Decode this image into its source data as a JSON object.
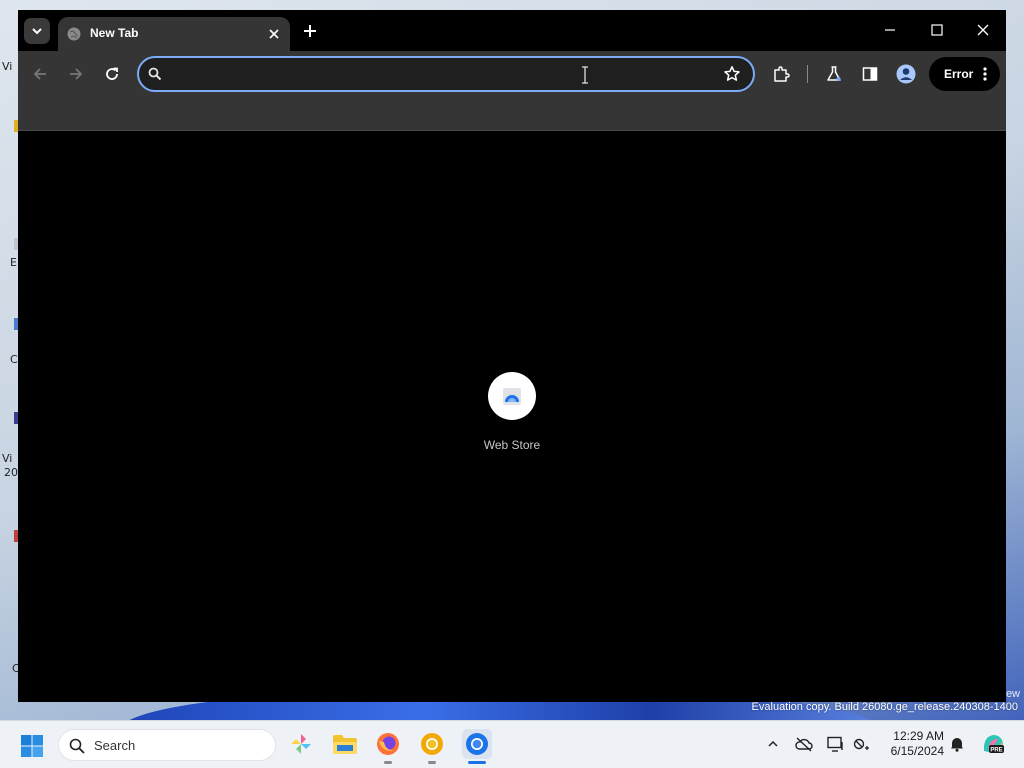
{
  "browser": {
    "tab": {
      "title": "New Tab"
    },
    "omnibox": {
      "value": "",
      "placeholder": ""
    },
    "profile_chip": {
      "label": "Error"
    },
    "accent_color": "#7cacf8"
  },
  "new_tab_page": {
    "shortcuts": [
      {
        "label": "Web Store"
      }
    ]
  },
  "system": {
    "watermark": "Evaluation copy. Build 26080.ge_release.240308-1400",
    "watermark_tail": "ew"
  },
  "desktop": {
    "fragments": [
      "Vi",
      "E",
      "C",
      "Vi",
      "20",
      "C"
    ]
  },
  "taskbar": {
    "search_label": "Search",
    "clock": {
      "time": "12:29 AM",
      "date": "6/15/2024"
    }
  }
}
